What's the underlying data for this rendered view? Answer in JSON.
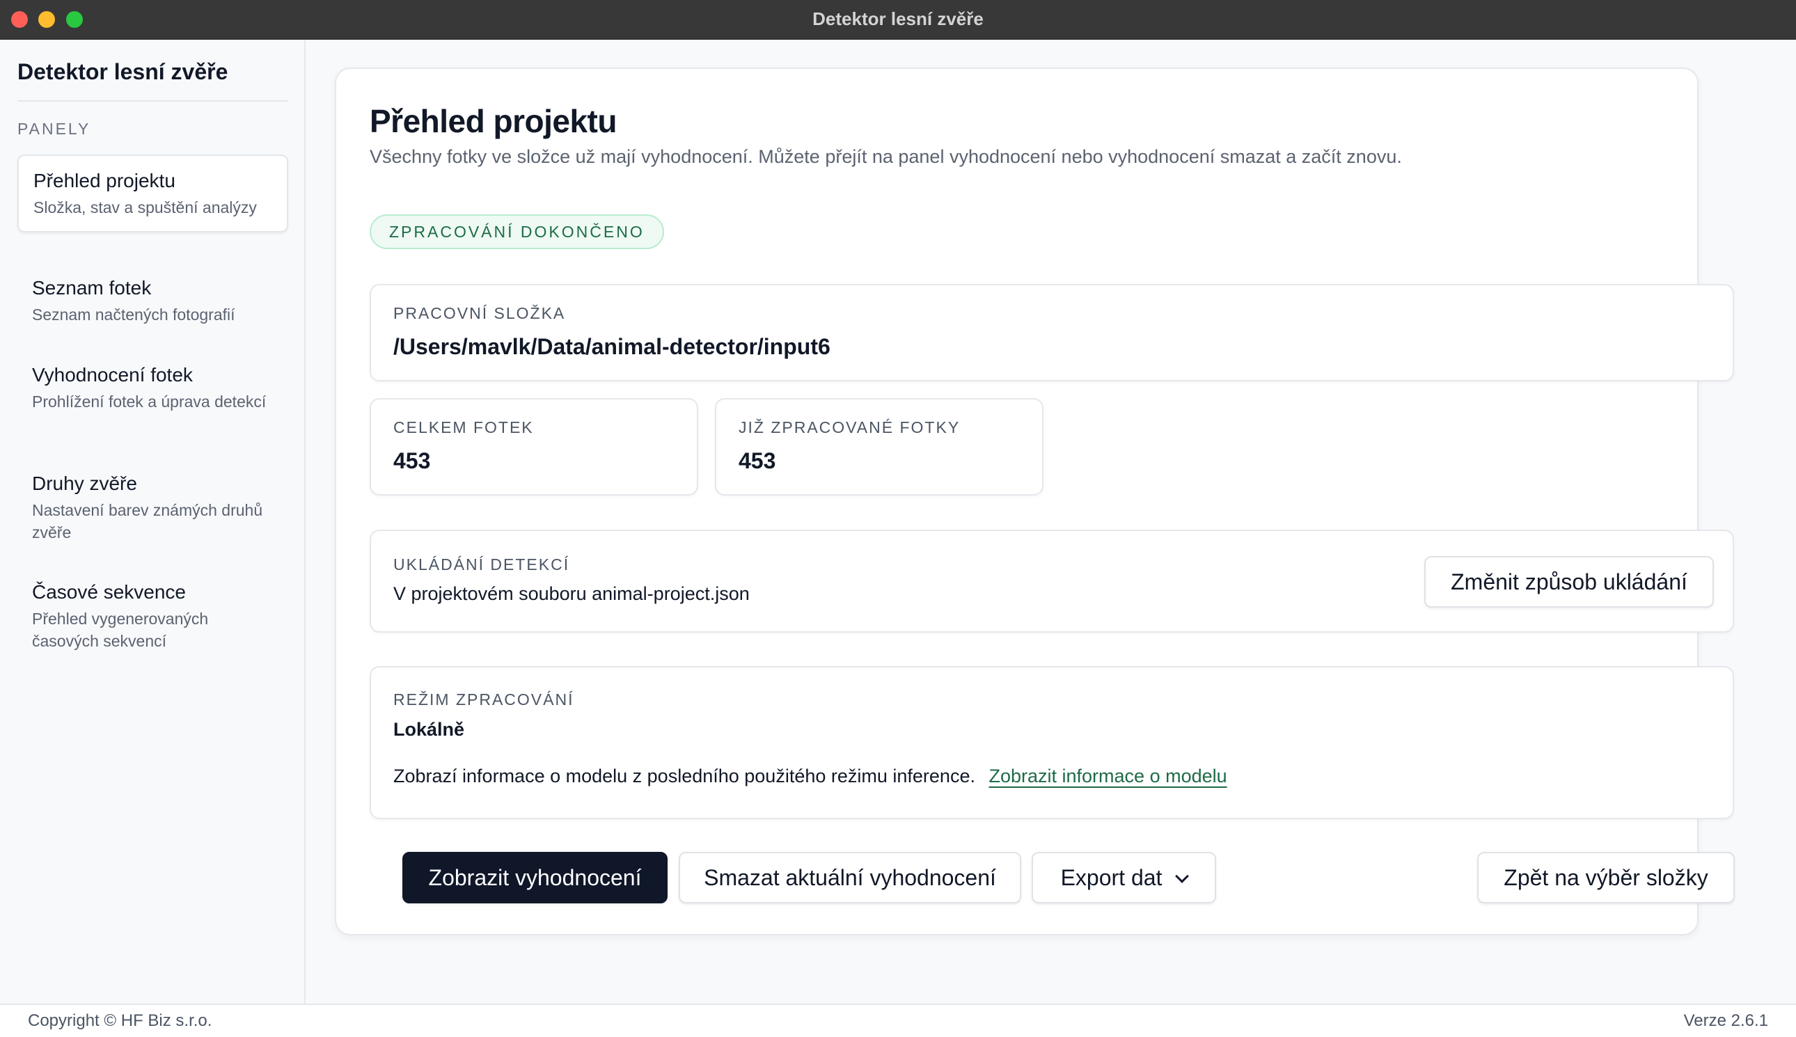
{
  "window": {
    "title": "Detektor lesní zvěře"
  },
  "sidebar": {
    "title": "Detektor lesní zvěře",
    "section": "PANELY",
    "items": [
      {
        "label": "Přehled projektu",
        "desc": "Složka, stav a spuštění analýzy",
        "active": true
      },
      {
        "label": "Seznam fotek",
        "desc": "Seznam načtených fotografií"
      },
      {
        "label": "Vyhodnocení fotek",
        "desc": "Prohlížení fotek a úprava detekcí"
      },
      {
        "label": "Druhy zvěře",
        "desc": "Nastavení barev známých druhů zvěře"
      },
      {
        "label": "Časové sekvence",
        "desc": "Přehled vygenerovaných časových sekvencí"
      }
    ]
  },
  "main": {
    "title": "Přehled projektu",
    "description": "Všechny fotky ve složce už mají vyhodnocení. Můžete přejít na panel vyhodnocení nebo vyhodnocení smazat a začít znovu.",
    "status_badge": "ZPRACOVÁNÍ DOKONČENO",
    "folder": {
      "label": "PRACOVNÍ SLOŽKA",
      "value": "/Users/mavlk/Data/animal-detector/input6"
    },
    "total_photos": {
      "label": "CELKEM FOTEK",
      "value": "453"
    },
    "processed_photos": {
      "label": "JIŽ ZPRACOVANÉ FOTKY",
      "value": "453"
    },
    "storage": {
      "label": "UKLÁDÁNÍ DETEKCÍ",
      "value": "V projektovém souboru animal-project.json",
      "button": "Změnit způsob ukládání"
    },
    "mode": {
      "label": "REŽIM ZPRACOVÁNÍ",
      "value": "Lokálně",
      "info": "Zobrazí informace o modelu z posledního použitého režimu inference.",
      "link": "Zobrazit informace o modelu"
    },
    "actions": {
      "show": "Zobrazit vyhodnocení",
      "delete": "Smazat aktuální vyhodnocení",
      "export": "Export dat",
      "back": "Zpět na výběr složky"
    }
  },
  "footer": {
    "copyright": "Copyright © HF Biz s.r.o.",
    "version": "Verze 2.6.1"
  },
  "colors": {
    "accent": "#0f1729",
    "success": "#1e6b47",
    "success_bg": "#eefaf3"
  }
}
